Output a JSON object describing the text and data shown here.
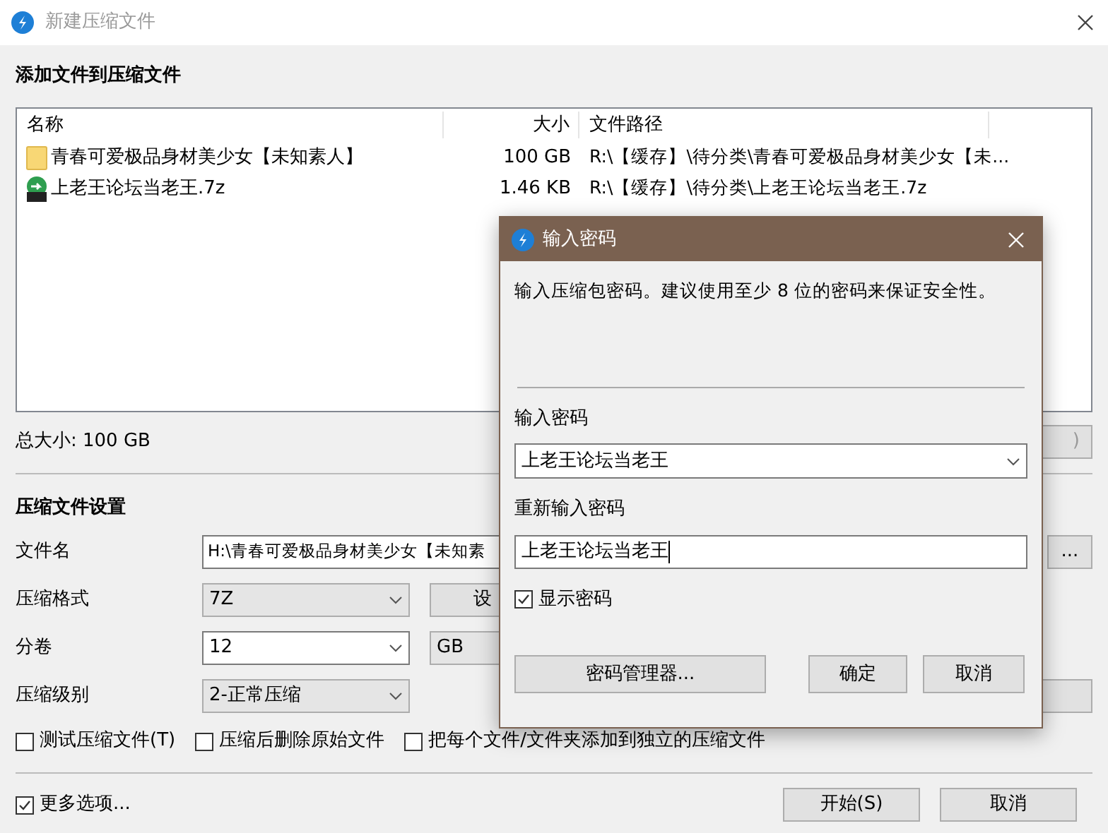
{
  "window": {
    "title": "新建压缩文件"
  },
  "add_section": {
    "heading": "添加文件到压缩文件"
  },
  "file_list": {
    "columns": [
      "名称",
      "大小",
      "文件路径"
    ],
    "rows": [
      {
        "kind": "folder",
        "name": "青春可爱极品身材美少女【未知素人】",
        "size": "100 GB",
        "path": "R:\\【缓存】\\待分类\\青春可爱极品身材美少女【未..."
      },
      {
        "kind": "archive",
        "name": "上老王论坛当老王.7z",
        "size": "1.46 KB",
        "path": "R:\\【缓存】\\待分类\\上老王论坛当老王.7z"
      }
    ]
  },
  "total_size": "总大小: 100 GB",
  "total_button": ")",
  "settings": {
    "heading": "压缩文件设置",
    "filename_label": "文件名",
    "filename_value": "H:\\青春可爱极品身材美少女【未知素",
    "browse_button": "...",
    "format_label": "压缩格式",
    "format_value": "7Z",
    "format_button": "设",
    "split_label": "分卷",
    "split_value": "12",
    "split_unit": "GB",
    "level_label": "压缩级别",
    "level_value": "2-正常压缩"
  },
  "options": [
    {
      "label": "测试压缩文件(T)",
      "checked": false
    },
    {
      "label": "压缩后删除原始文件",
      "checked": false
    },
    {
      "label": "把每个文件/文件夹添加到独立的压缩文件",
      "checked": false
    }
  ],
  "more_options": {
    "label": "更多选项...",
    "checked": true
  },
  "buttons": [
    "开始(S)",
    "取消"
  ],
  "dialog": {
    "title": "输入密码",
    "message": "输入压缩包密码。建议使用至少 8 位的密码来保证安全性。",
    "password_label": "输入密码",
    "password_value": "上老王论坛当老王",
    "confirm_label": "重新输入密码",
    "confirm_value": "上老王论坛当老王",
    "show_password": {
      "label": "显示密码",
      "checked": true
    },
    "manager_button": "密码管理器...",
    "buttons": [
      "确定",
      "取消"
    ]
  }
}
